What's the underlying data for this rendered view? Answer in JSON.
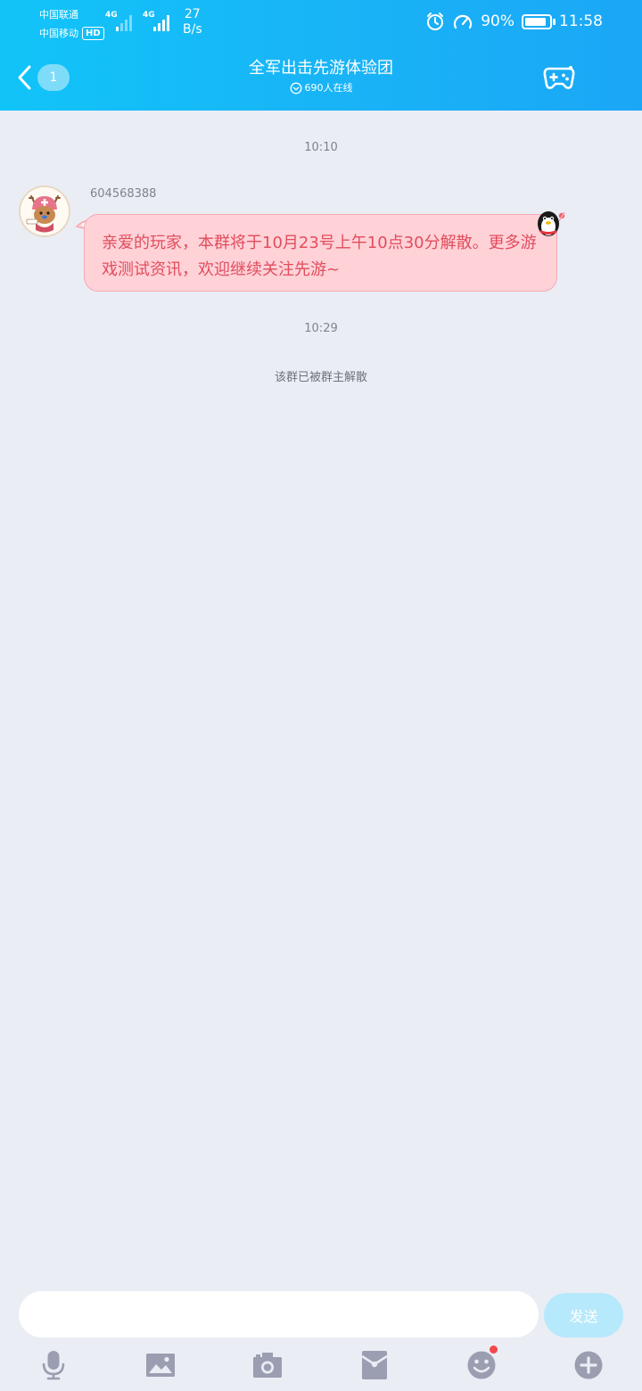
{
  "status_bar": {
    "carrier_1": "中国联通",
    "carrier_2": "中国移动",
    "hd_badge": "HD",
    "network_1": "4G",
    "network_2": "4G",
    "speed_value": "27",
    "speed_unit": "B/s",
    "battery_text": "90%",
    "battery_level": 0.9,
    "time": "11:58"
  },
  "title_bar": {
    "unread_count": "1",
    "group_name": "全军出击先游体验团",
    "online_count": "690人在线"
  },
  "messages": {
    "time_1": "10:10",
    "sender_id": "604568388",
    "message_text": "亲爱的玩家，本群将于10月23号上午10点30分解散。更多游戏测试资讯，欢迎继续关注先游~",
    "time_2": "10:29",
    "system_notice": "该群已被群主解散"
  },
  "input_bar": {
    "placeholder": "",
    "send_label": "发送"
  },
  "toolbar_icons": [
    "microphone-icon",
    "image-icon",
    "camera-icon",
    "red-packet-icon",
    "emoji-icon",
    "plus-icon"
  ],
  "colors": {
    "header_start": "#11c4f8",
    "header_end": "#1aa7f6",
    "background": "#ebedf5",
    "bubble_fill": "#ffd2d8",
    "bubble_text": "#e14d5c",
    "send_button": "#b6e9fb",
    "toolbar_icon": "#9a9eb0",
    "notification_dot": "#f04848"
  }
}
